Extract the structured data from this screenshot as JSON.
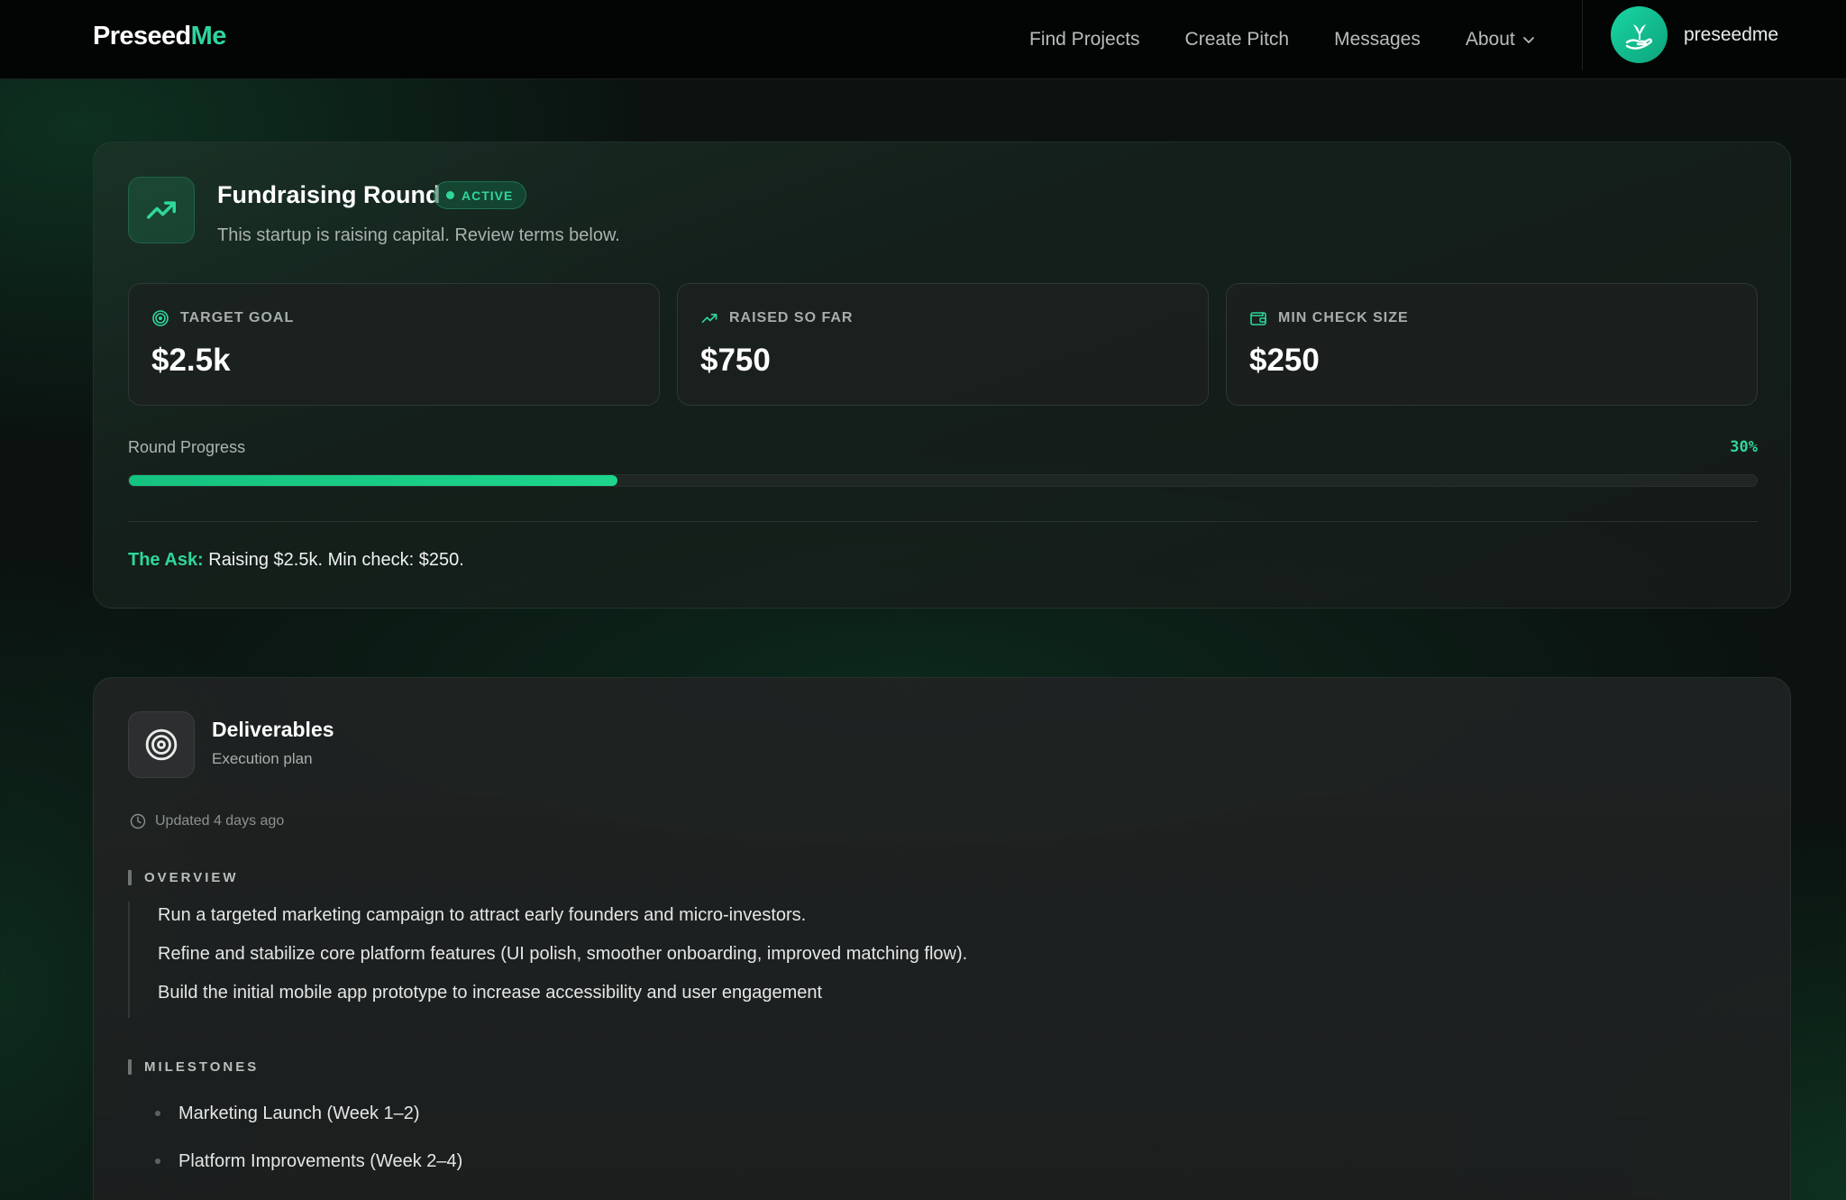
{
  "nav": {
    "logo_a": "Preseed",
    "logo_b": "Me",
    "links": [
      "Find Projects",
      "Create Pitch",
      "Messages",
      "About"
    ],
    "username": "preseedme"
  },
  "fundraising": {
    "title": "Fundraising Round",
    "badge": "ACTIVE",
    "subtitle": "This startup is raising capital. Review terms below.",
    "stats": [
      {
        "label": "TARGET GOAL",
        "value": "$2.5k",
        "icon": "target-icon"
      },
      {
        "label": "RAISED SO FAR",
        "value": "$750",
        "icon": "trending-up-icon"
      },
      {
        "label": "MIN CHECK SIZE",
        "value": "$250",
        "icon": "wallet-icon"
      }
    ],
    "progress_label": "Round Progress",
    "progress_text": "30%",
    "progress_fraction": 0.3,
    "ask_key": "The Ask:",
    "ask_text": " Raising $2.5k. Min check: $250."
  },
  "deliverables": {
    "title": "Deliverables",
    "subtitle": "Execution plan",
    "updated": "Updated 4 days ago",
    "overview_heading": "OVERVIEW",
    "overview": [
      "Run a targeted marketing campaign to attract early founders and micro-investors.",
      "Refine and stabilize core platform features (UI polish, smoother onboarding, improved matching flow).",
      "Build the initial mobile app prototype to increase accessibility and user engagement"
    ],
    "milestones_heading": "MILESTONES",
    "milestones": [
      "Marketing Launch (Week 1–2)",
      "Platform Improvements (Week 2–4)"
    ]
  },
  "colors": {
    "accent": "#2fd79a",
    "background": "#0b1210",
    "nav_bg": "#030404"
  }
}
